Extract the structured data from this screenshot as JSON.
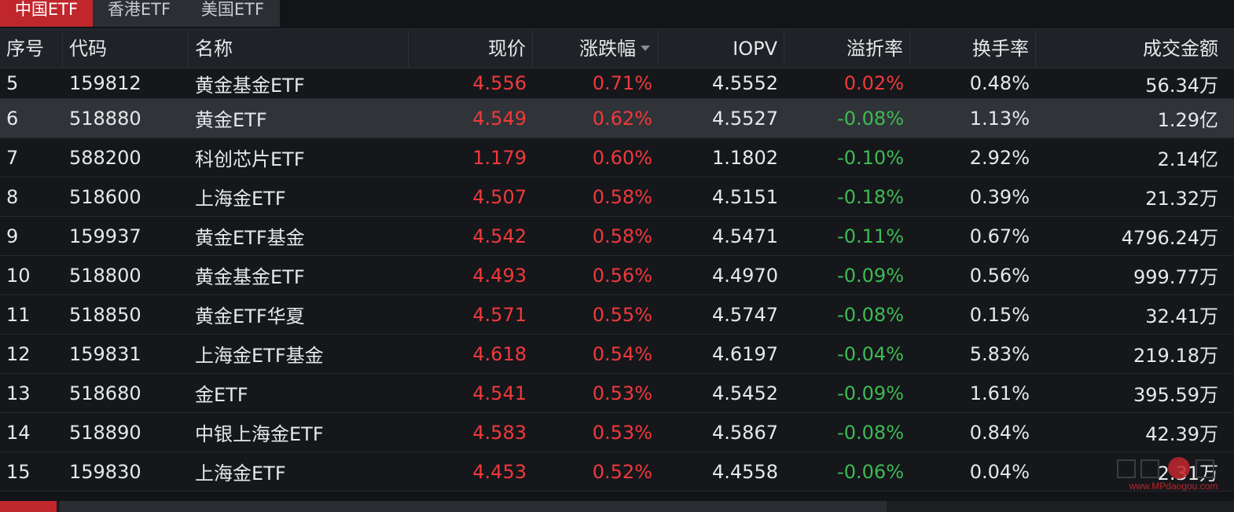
{
  "tabs": [
    {
      "label": "中国ETF",
      "active": true
    },
    {
      "label": "香港ETF",
      "active": false
    },
    {
      "label": "美国ETF",
      "active": false
    }
  ],
  "columns": {
    "index": "序号",
    "code": "代码",
    "name": "名称",
    "price": "现价",
    "change": "涨跌幅",
    "iopv": "IOPV",
    "premium": "溢折率",
    "turnover": "换手率",
    "amount": "成交金额"
  },
  "sort": {
    "column": "change",
    "direction": "desc"
  },
  "rows": [
    {
      "index": "5",
      "code": "159812",
      "name": "黄金基金ETF",
      "price": "4.556",
      "change": "0.71%",
      "iopv": "4.5552",
      "premium": "0.02%",
      "turnover": "0.48%",
      "amount": "56.34万"
    },
    {
      "index": "6",
      "code": "518880",
      "name": "黄金ETF",
      "price": "4.549",
      "change": "0.62%",
      "iopv": "4.5527",
      "premium": "-0.08%",
      "turnover": "1.13%",
      "amount": "1.29亿"
    },
    {
      "index": "7",
      "code": "588200",
      "name": "科创芯片ETF",
      "price": "1.179",
      "change": "0.60%",
      "iopv": "1.1802",
      "premium": "-0.10%",
      "turnover": "2.92%",
      "amount": "2.14亿"
    },
    {
      "index": "8",
      "code": "518600",
      "name": "上海金ETF",
      "price": "4.507",
      "change": "0.58%",
      "iopv": "4.5151",
      "premium": "-0.18%",
      "turnover": "0.39%",
      "amount": "21.32万"
    },
    {
      "index": "9",
      "code": "159937",
      "name": "黄金ETF基金",
      "price": "4.542",
      "change": "0.58%",
      "iopv": "4.5471",
      "premium": "-0.11%",
      "turnover": "0.67%",
      "amount": "4796.24万"
    },
    {
      "index": "10",
      "code": "518800",
      "name": "黄金基金ETF",
      "price": "4.493",
      "change": "0.56%",
      "iopv": "4.4970",
      "premium": "-0.09%",
      "turnover": "0.56%",
      "amount": "999.77万"
    },
    {
      "index": "11",
      "code": "518850",
      "name": "黄金ETF华夏",
      "price": "4.571",
      "change": "0.55%",
      "iopv": "4.5747",
      "premium": "-0.08%",
      "turnover": "0.15%",
      "amount": "32.41万"
    },
    {
      "index": "12",
      "code": "159831",
      "name": "上海金ETF基金",
      "price": "4.618",
      "change": "0.54%",
      "iopv": "4.6197",
      "premium": "-0.04%",
      "turnover": "5.83%",
      "amount": "219.18万"
    },
    {
      "index": "13",
      "code": "518680",
      "name": "金ETF",
      "price": "4.541",
      "change": "0.53%",
      "iopv": "4.5452",
      "premium": "-0.09%",
      "turnover": "1.61%",
      "amount": "395.59万"
    },
    {
      "index": "14",
      "code": "518890",
      "name": "中银上海金ETF",
      "price": "4.583",
      "change": "0.53%",
      "iopv": "4.5867",
      "premium": "-0.08%",
      "turnover": "0.84%",
      "amount": "42.39万"
    },
    {
      "index": "15",
      "code": "159830",
      "name": "上海金ETF",
      "price": "4.453",
      "change": "0.52%",
      "iopv": "4.4558",
      "premium": "-0.06%",
      "turnover": "0.04%",
      "amount": "2.31万"
    }
  ],
  "highlight_row_index": "6",
  "watermark": {
    "text": "www.MPdaogou.com"
  },
  "colors": {
    "up": "#f0393b",
    "down": "#3dbb52",
    "accent": "#c0272d",
    "background": "#121418",
    "header_bg": "#1f2226",
    "highlight_bg": "#303338"
  }
}
